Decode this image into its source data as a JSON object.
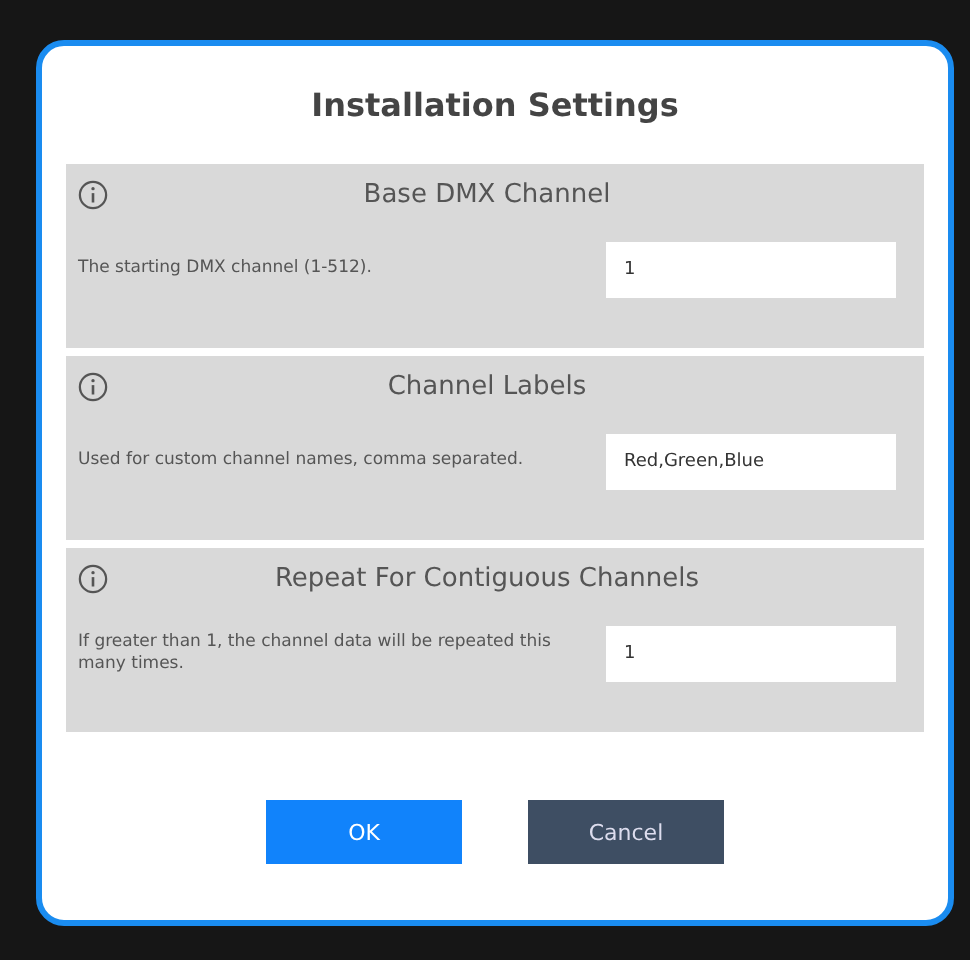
{
  "dialog": {
    "title": "Installation Settings",
    "settings": [
      {
        "title": "Base DMX Channel",
        "description": "The starting DMX channel (1-512).",
        "value": "1"
      },
      {
        "title": "Channel Labels",
        "description": "Used for custom channel names, comma separated.",
        "value": "Red,Green,Blue"
      },
      {
        "title": "Repeat For Contiguous Channels",
        "description": "If greater than 1, the channel data will be repeated this many times.",
        "value": "1"
      }
    ],
    "buttons": [
      {
        "label": "OK",
        "kind": "primary"
      },
      {
        "label": "Cancel",
        "kind": "secondary"
      }
    ]
  }
}
